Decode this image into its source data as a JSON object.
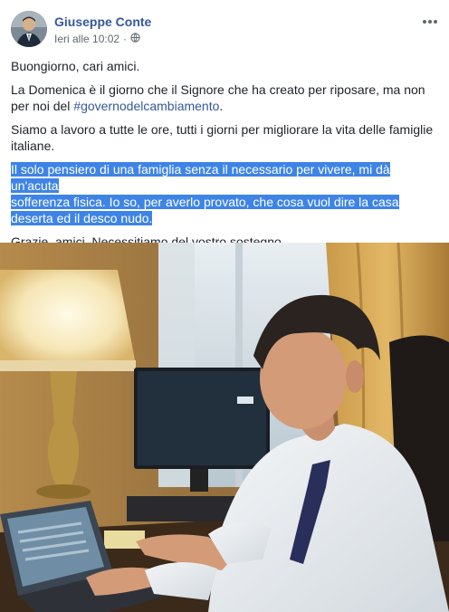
{
  "post": {
    "author": "Giuseppe Conte",
    "timestamp": "Ieri alle 10:02",
    "separator": "·",
    "privacy_icon": "globe-icon",
    "more_icon": "ellipsis-icon",
    "paragraphs": {
      "p1": "Buongiorno, cari amici.",
      "p2_before": "La Domenica è il giorno che il Signore che ha creato per riposare, ma non per noi del ",
      "p2_hashtag": "#governodelcambiamento",
      "p2_after": ".",
      "p3": "Siamo a lavoro a tutte le ore, tutti i giorni per migliorare la vita delle famiglie italiane.",
      "p4_line1": "Il solo pensiero di una famiglia senza il necessario per vivere, mi dà un'acuta",
      "p4_line2": "sofferenza fisica. Io so, per averlo provato, che cosa vuol dire la casa",
      "p4_line3": "deserta ed il desco nudo.",
      "p5": "Grazie, amici. Necessitiamo del vostro sostegno."
    },
    "highlight_color": "#3e84e6",
    "link_color": "#365899"
  }
}
